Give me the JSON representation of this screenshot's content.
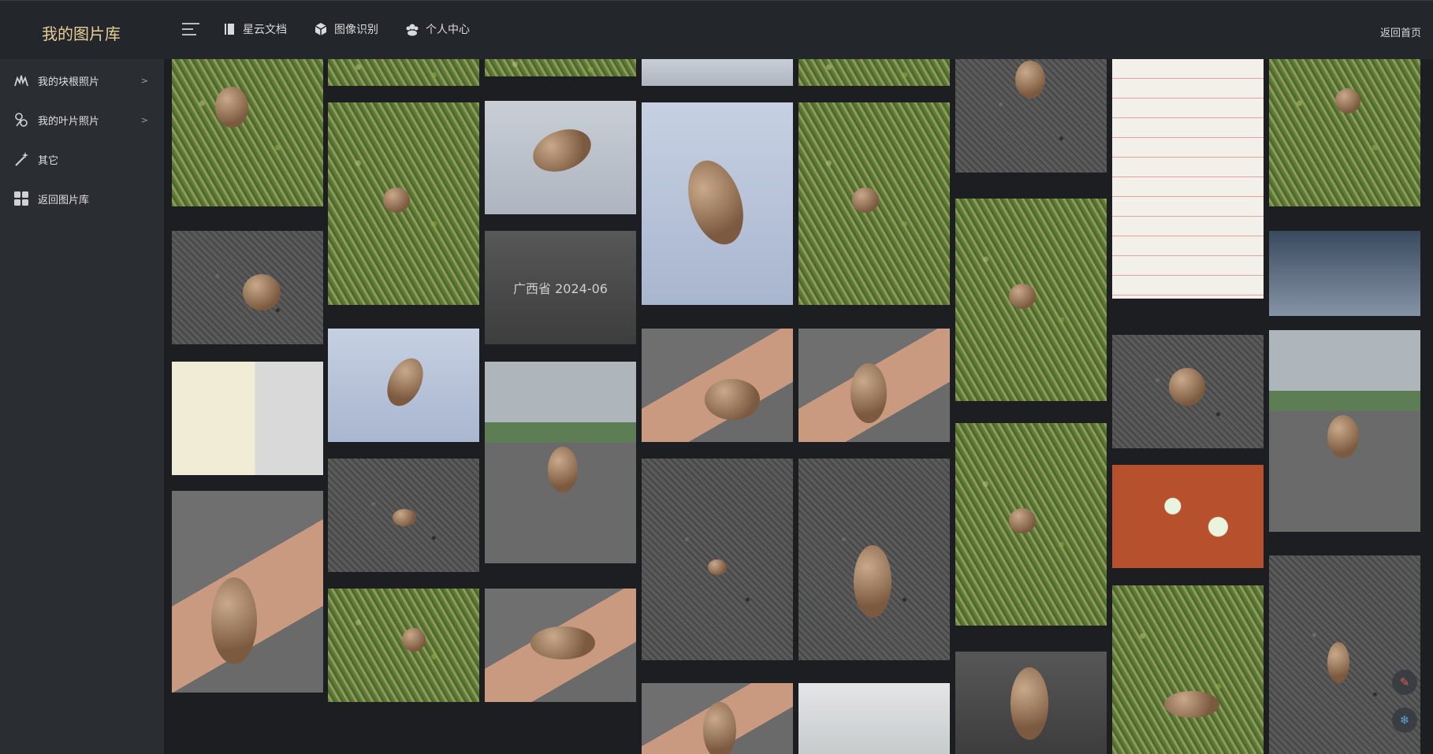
{
  "brand": {
    "title": "我的图片库"
  },
  "topnav": {
    "items": [
      {
        "label": "星云文档",
        "icon": "book-icon"
      },
      {
        "label": "图像识别",
        "icon": "cube-icon"
      },
      {
        "label": "个人中心",
        "icon": "people-icon"
      }
    ],
    "back_home": "返回首页"
  },
  "sidebar": {
    "items": [
      {
        "label": "我的块根照片",
        "icon": "root-icon",
        "has_submenu": true
      },
      {
        "label": "我的叶片照片",
        "icon": "leaf-icon",
        "has_submenu": true
      },
      {
        "label": "其它",
        "icon": "magic-wand-icon",
        "has_submenu": false
      },
      {
        "label": "返回图片库",
        "icon": "grid-icon",
        "has_submenu": false
      }
    ],
    "arrow": ">"
  },
  "gallery": {
    "photos": [
      {
        "alt": "grass-tuber"
      },
      {
        "alt": "asphalt-tuber"
      },
      {
        "alt": "ruler-sample"
      },
      {
        "alt": "hand-tuber"
      },
      {
        "alt": "grass"
      },
      {
        "alt": "grass-tuber"
      },
      {
        "alt": "blue-paper-tuber"
      },
      {
        "alt": "asphalt-tubers"
      },
      {
        "alt": "grass-tuber"
      },
      {
        "alt": "grass"
      },
      {
        "alt": "paper-tuber"
      },
      {
        "alt": "province-placeholder",
        "caption": "广西省  2024-06"
      },
      {
        "alt": "park-hand-tuber"
      },
      {
        "alt": "hand-tuber"
      },
      {
        "alt": "paper"
      },
      {
        "alt": "blue-paper-tuber"
      },
      {
        "alt": "hand-tuber"
      },
      {
        "alt": "asphalt-tuber"
      },
      {
        "alt": "hand-tuber"
      },
      {
        "alt": "grass"
      },
      {
        "alt": "grass-tuber"
      },
      {
        "alt": "hand-tuber"
      },
      {
        "alt": "asphalt-tuber"
      },
      {
        "alt": "bottle"
      },
      {
        "alt": "asphalt-tuber"
      },
      {
        "alt": "grass-tuber"
      },
      {
        "alt": "grass-tuber"
      },
      {
        "alt": "hand-tuber"
      },
      {
        "alt": "notebook"
      },
      {
        "alt": "asphalt-tuber"
      },
      {
        "alt": "melon-pieces"
      },
      {
        "alt": "grass-tuber"
      },
      {
        "alt": "grass-tuber"
      },
      {
        "alt": "monitor"
      },
      {
        "alt": "park-hand-tuber"
      },
      {
        "alt": "asphalt-tuber"
      }
    ]
  }
}
